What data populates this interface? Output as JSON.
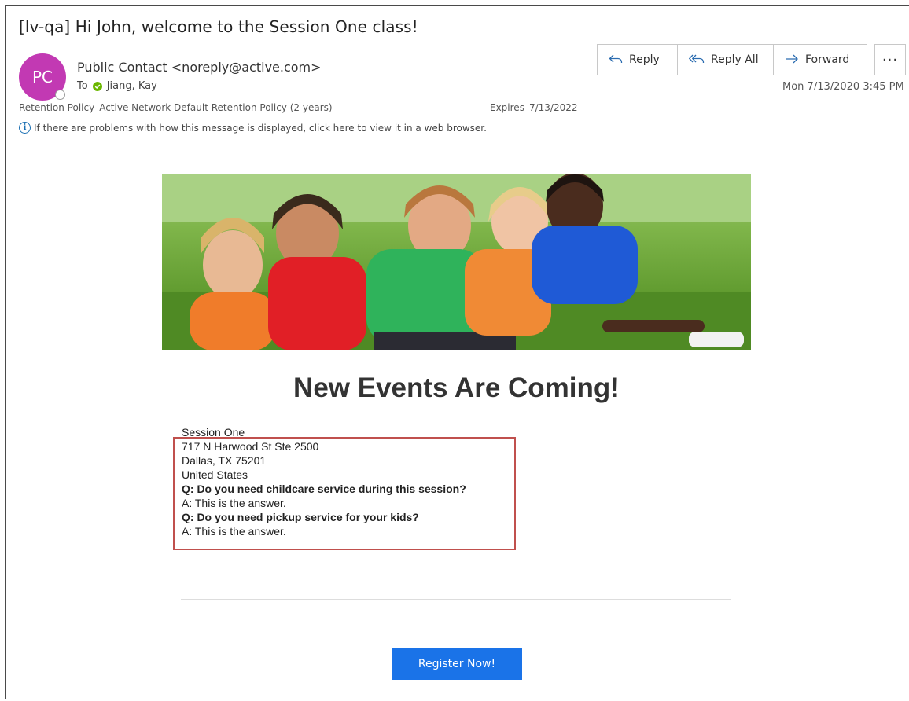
{
  "email": {
    "subject": "[lv-qa] Hi John, welcome to the Session One class!",
    "sender": {
      "initials": "PC",
      "display": "Public Contact <noreply@active.com>",
      "avatar_color": "#c239b3"
    },
    "to": {
      "label": "To",
      "recipient": "Jiang, Kay"
    },
    "retention": {
      "label": "Retention Policy",
      "value": "Active Network Default Retention Policy (2 years)"
    },
    "expires": {
      "label": "Expires",
      "value": "7/13/2022"
    },
    "info_bar": "If there are problems with how this message is displayed, click here to view it in a web browser.",
    "date": "Mon 7/13/2020 3:45 PM"
  },
  "toolbar": {
    "reply": "Reply",
    "reply_all": "Reply All",
    "forward": "Forward",
    "more": "···"
  },
  "body": {
    "headline": "New Events Are Coming!",
    "session_name": "Session One",
    "address_line1": "717 N Harwood St Ste 2500",
    "address_line2": "Dallas, TX 75201",
    "country": "United States",
    "q1": "Q: Do you need childcare service during this session?",
    "a1": "A: This is the answer.",
    "q2": "Q: Do you need pickup service for your kids?",
    "a2": "A: This is the answer.",
    "register_button": "Register Now!",
    "register_color": "#1a73e8",
    "highlight_color": "#c0504d"
  }
}
